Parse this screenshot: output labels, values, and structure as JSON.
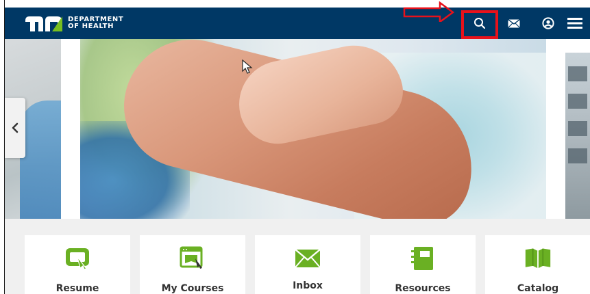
{
  "header": {
    "logo_line1": "DEPARTMENT",
    "logo_line2": "OF HEALTH",
    "background_color": "#003865"
  },
  "nav_icons": [
    "search-icon",
    "mail-icon",
    "user-icon",
    "menu-icon"
  ],
  "annotation": {
    "color": "#e8121b"
  },
  "tiles": [
    {
      "label": "Resume",
      "icon": "resume-icon"
    },
    {
      "label": "My Courses",
      "icon": "courses-icon"
    },
    {
      "label": "Inbox",
      "icon": "envelope-icon"
    },
    {
      "label": "Resources",
      "icon": "notebook-icon"
    },
    {
      "label": "Catalog",
      "icon": "book-icon"
    }
  ],
  "colors": {
    "accent_green": "#6ab023",
    "tile_text": "#333333"
  }
}
